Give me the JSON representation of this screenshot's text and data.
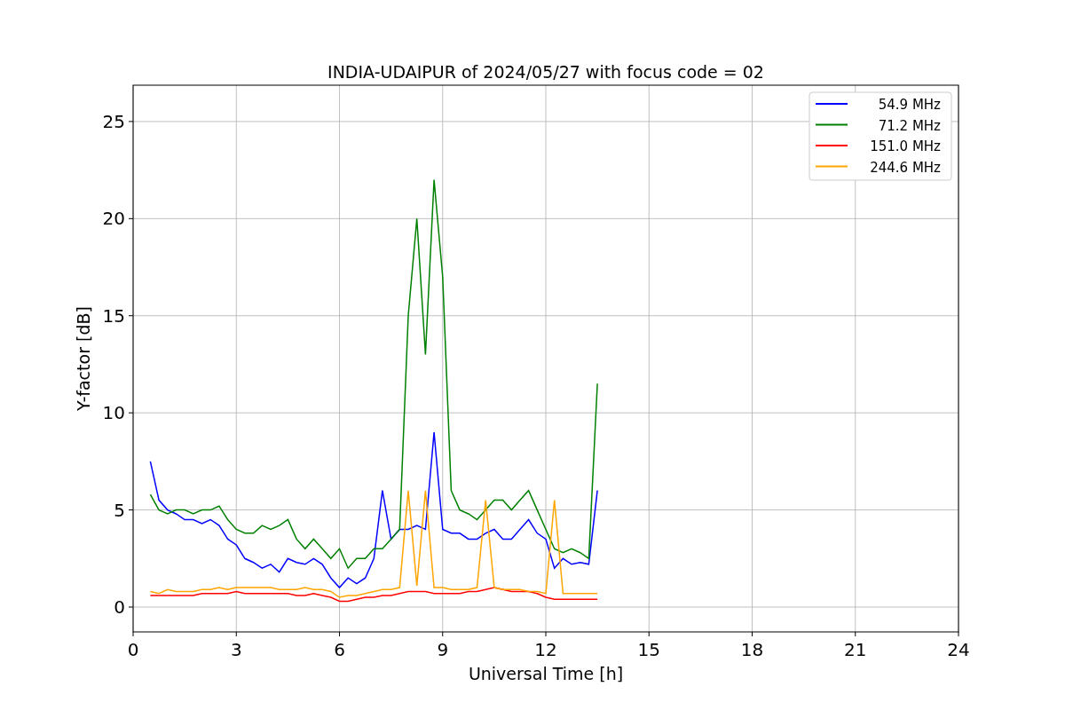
{
  "chart_data": {
    "type": "line",
    "title": "INDIA-UDAIPUR of 2024/05/27 with focus code = 02",
    "xlabel": "Universal Time [h]",
    "ylabel": "Y-factor [dB]",
    "x": [
      0.5,
      0.75,
      1,
      1.25,
      1.5,
      1.75,
      2,
      2.25,
      2.5,
      2.75,
      3,
      3.25,
      3.5,
      3.75,
      4,
      4.25,
      4.5,
      4.75,
      5,
      5.25,
      5.5,
      5.75,
      6,
      6.25,
      6.5,
      6.75,
      7,
      7.25,
      7.5,
      7.75,
      8,
      8.25,
      8.5,
      8.75,
      9,
      9.25,
      9.5,
      9.75,
      10,
      10.25,
      10.5,
      10.75,
      11,
      11.25,
      11.5,
      11.75,
      12,
      12.25,
      12.5,
      12.75,
      13,
      13.25,
      13.5
    ],
    "series": [
      {
        "name": "54.9 MHz",
        "color": "#0000ff",
        "values": [
          7.5,
          5.5,
          5,
          4.8,
          4.5,
          4.5,
          4.3,
          4.5,
          4.2,
          3.5,
          3.2,
          2.5,
          2.3,
          2,
          2.2,
          1.8,
          2.5,
          2.3,
          2.2,
          2.5,
          2.2,
          1.5,
          1,
          1.5,
          1.2,
          1.5,
          2.5,
          6,
          3.5,
          4,
          4,
          4.2,
          4,
          9,
          4,
          3.8,
          3.8,
          3.5,
          3.5,
          3.8,
          4,
          3.5,
          3.5,
          4,
          4.5,
          3.8,
          3.5,
          2,
          2.5,
          2.2,
          2.3,
          2.2,
          6
        ]
      },
      {
        "name": "71.2 MHz",
        "color": "#008000",
        "values": [
          5.8,
          5,
          4.8,
          5,
          5,
          4.8,
          5,
          5,
          5.2,
          4.5,
          4,
          3.8,
          3.8,
          4.2,
          4,
          4.2,
          4.5,
          3.5,
          3,
          3.5,
          3,
          2.5,
          3,
          2,
          2.5,
          2.5,
          3,
          3,
          3.5,
          4,
          15,
          20,
          13,
          22,
          17,
          6,
          5,
          4.8,
          4.5,
          5,
          5.5,
          5.5,
          5,
          5.5,
          6,
          5,
          4,
          3,
          2.8,
          3,
          2.8,
          2.5,
          11.5
        ]
      },
      {
        "name": "151.0 MHz",
        "color": "#ff0000",
        "values": [
          0.6,
          0.6,
          0.6,
          0.6,
          0.6,
          0.6,
          0.7,
          0.7,
          0.7,
          0.7,
          0.8,
          0.7,
          0.7,
          0.7,
          0.7,
          0.7,
          0.7,
          0.6,
          0.6,
          0.7,
          0.6,
          0.5,
          0.3,
          0.3,
          0.4,
          0.5,
          0.5,
          0.6,
          0.6,
          0.7,
          0.8,
          0.8,
          0.8,
          0.7,
          0.7,
          0.7,
          0.7,
          0.8,
          0.8,
          0.9,
          1,
          0.9,
          0.8,
          0.8,
          0.8,
          0.7,
          0.5,
          0.4,
          0.4,
          0.4,
          0.4,
          0.4,
          0.4
        ]
      },
      {
        "name": "244.6 MHz",
        "color": "#ffa500",
        "values": [
          0.8,
          0.7,
          0.9,
          0.8,
          0.8,
          0.8,
          0.9,
          0.9,
          1,
          0.9,
          1,
          1,
          1,
          1,
          1,
          0.9,
          0.9,
          0.9,
          1,
          0.9,
          0.9,
          0.8,
          0.5,
          0.6,
          0.6,
          0.7,
          0.8,
          0.9,
          0.9,
          1,
          6,
          1.1,
          6,
          1,
          1,
          0.9,
          0.9,
          0.9,
          1,
          5.5,
          1,
          0.9,
          0.9,
          0.9,
          0.8,
          0.8,
          0.7,
          5.5,
          0.7,
          0.7,
          0.7,
          0.7,
          0.7
        ]
      }
    ],
    "xlim": [
      0,
      24
    ],
    "ylim": [
      -1.28,
      26.87
    ],
    "xticks": [
      0,
      3,
      6,
      9,
      12,
      15,
      18,
      21,
      24
    ],
    "yticks": [
      0,
      5,
      10,
      15,
      20,
      25
    ],
    "grid": true,
    "legend": true
  }
}
